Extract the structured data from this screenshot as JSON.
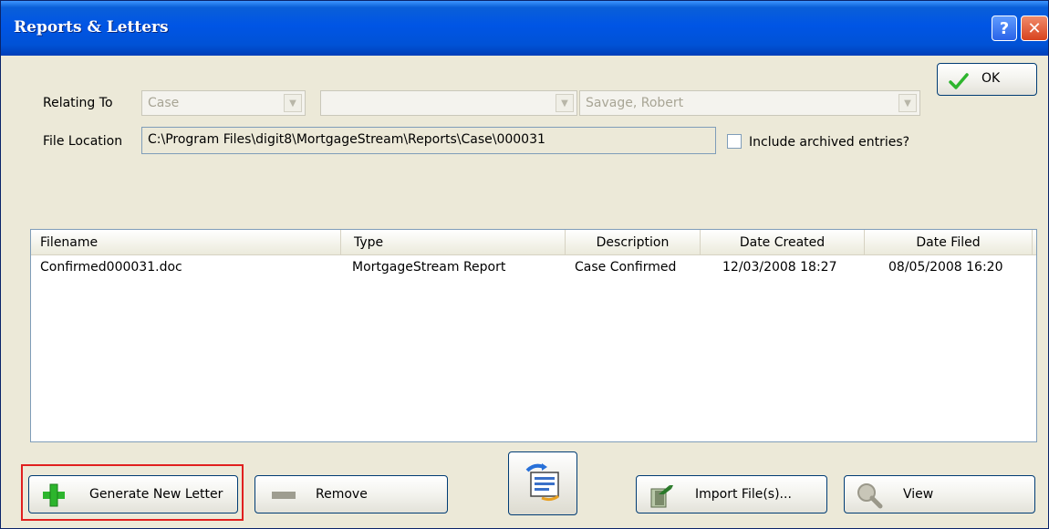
{
  "window": {
    "title": "Reports & Letters",
    "help_glyph": "?",
    "close_glyph": "✕"
  },
  "ok_button": {
    "label": "OK"
  },
  "relating_to": {
    "label": "Relating To",
    "combo1": "Case",
    "combo2": "",
    "combo3": "Savage, Robert"
  },
  "file_location": {
    "label": "File Location",
    "value": "C:\\Program Files\\digit8\\MortgageStream\\Reports\\Case\\000031"
  },
  "include_archived": {
    "label": "Include archived entries?",
    "checked": false
  },
  "list": {
    "columns": [
      "Filename",
      "Type",
      "Description",
      "Date Created",
      "Date Filed"
    ],
    "rows": [
      [
        "Confirmed000031.doc",
        "MortgageStream Report",
        "Case Confirmed",
        "12/03/2008 18:27",
        "08/05/2008 16:20"
      ]
    ]
  },
  "buttons": {
    "generate": "Generate New Letter",
    "remove": "Remove",
    "import": "Import File(s)...",
    "view": "View"
  },
  "icons": {
    "ok": "checkmark-icon",
    "generate": "plus-icon",
    "remove": "minus-icon",
    "center": "refresh-document-icon",
    "import": "import-icon",
    "view": "magnifier-icon"
  },
  "colors": {
    "titlebar": "#0055e5",
    "highlight": "#e0201f",
    "plus_green": "#2db52d"
  }
}
